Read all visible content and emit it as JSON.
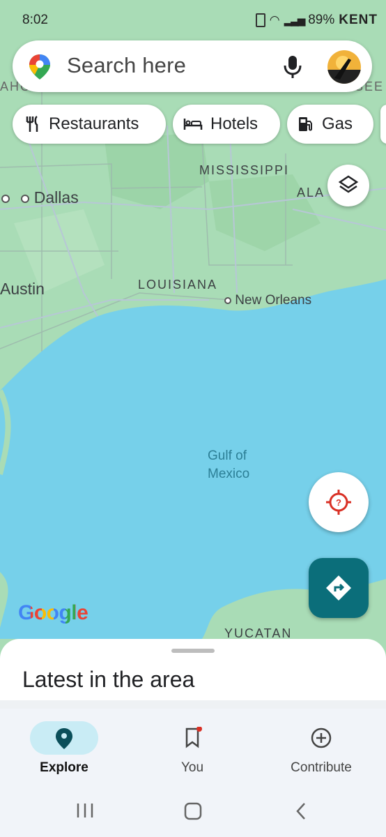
{
  "status_bar": {
    "time": "8:02",
    "battery": "89%",
    "signal_text": "KENT"
  },
  "search": {
    "placeholder": "Search here"
  },
  "chips": [
    {
      "label": "Restaurants",
      "icon": "restaurant-icon"
    },
    {
      "label": "Hotels",
      "icon": "hotel-icon"
    },
    {
      "label": "Gas",
      "icon": "gas-station-icon"
    }
  ],
  "map_labels": {
    "mississippi": "MISSISSIPPI",
    "louisiana": "LOUISIANA",
    "alabama": "ALA",
    "tennessee": "TENNESSEE",
    "oklahoma": "AHOMA",
    "dallas": "Dallas",
    "austin": "Austin",
    "new_orleans": "New Orleans",
    "gulf_line1": "Gulf of",
    "gulf_line2": "Mexico",
    "yucatan": "YUCATAN",
    "google": "Google"
  },
  "sheet": {
    "title": "Latest in the area"
  },
  "bottom_nav": [
    {
      "label": "Explore",
      "icon": "explore-pin-icon",
      "active": true
    },
    {
      "label": "You",
      "icon": "saved-bookmark-icon",
      "active": false
    },
    {
      "label": "Contribute",
      "icon": "add-circle-icon",
      "active": false
    }
  ],
  "colors": {
    "water": "#76d0ea",
    "land": "#a8dab5",
    "teal_button": "#0b6e7a",
    "explore_pill": "#c9ecf5"
  }
}
